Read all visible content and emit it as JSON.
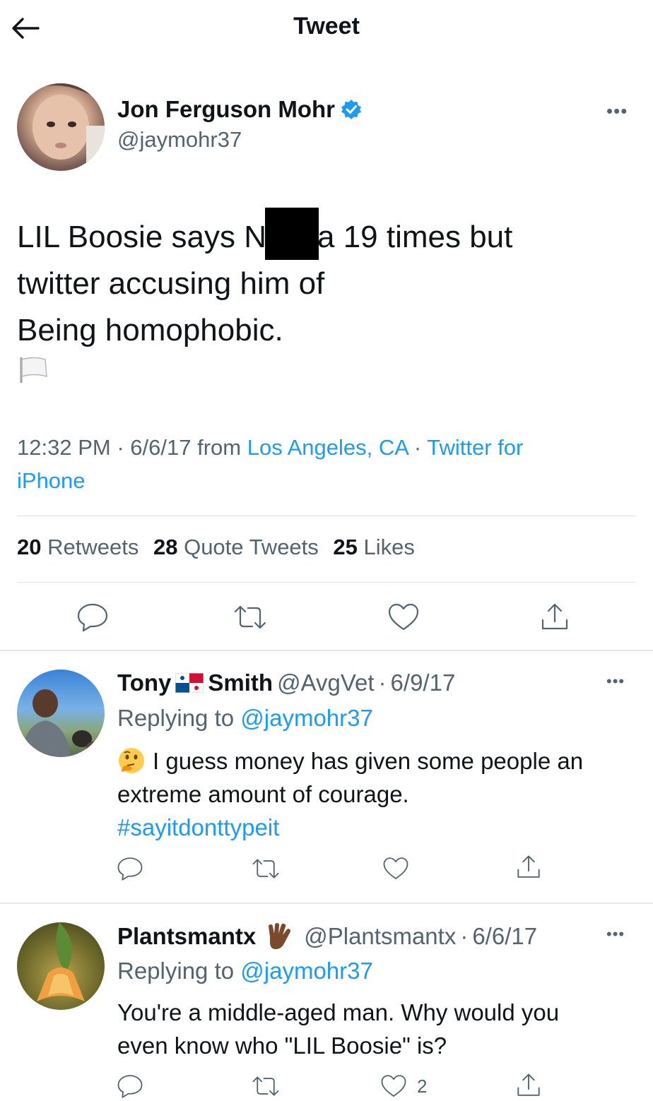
{
  "header": {
    "title": "Tweet",
    "back_icon": "arrow-left-icon"
  },
  "main_tweet": {
    "author": {
      "name": "Jon Ferguson Mohr",
      "handle": "@jaymohr37",
      "verified": true
    },
    "text_line1_before": "LIL Boosie says N",
    "text_line1_after": "a 19 times but",
    "text_line2": "twitter accusing him of",
    "text_line3": "Being homophobic.",
    "emoji": "white-flag-icon",
    "time": "12:32 PM",
    "date": "6/6/17",
    "from_label": "from",
    "location": "Los Angeles, CA",
    "source_part1": "Twitter for",
    "source_part2": "iPhone",
    "stats": {
      "retweets_count": "20",
      "retweets_label": "Retweets",
      "quotes_count": "28",
      "quotes_label": "Quote Tweets",
      "likes_count": "25",
      "likes_label": "Likes"
    }
  },
  "replies": [
    {
      "name_first": "Tony",
      "name_flag": "panama-flag-icon",
      "name_last": "Smith",
      "handle": "@AvgVet",
      "date": "6/9/17",
      "replying_prefix": "Replying to",
      "replying_to": "@jaymohr37",
      "emoji": "thinking-face-icon",
      "text_line1": "I guess money has given some people an",
      "text_line2": "extreme amount of courage.",
      "hashtag": "#sayitdonttypeit",
      "like_count": ""
    },
    {
      "name": "Plantsmantx",
      "name_emoji": "vulcan-salute-icon",
      "handle": "@Plantsmantx",
      "date": "6/6/17",
      "replying_prefix": "Replying to",
      "replying_to": "@jaymohr37",
      "text_line1": "You're a middle-aged man. Why would you",
      "text_line2": "even know who \"LIL Boosie\" is?",
      "like_count": "2"
    }
  ],
  "separator": "·",
  "colors": {
    "link": "#1d9bf0",
    "muted": "#536471",
    "text": "#0f1419",
    "divider": "#e7eaec"
  }
}
